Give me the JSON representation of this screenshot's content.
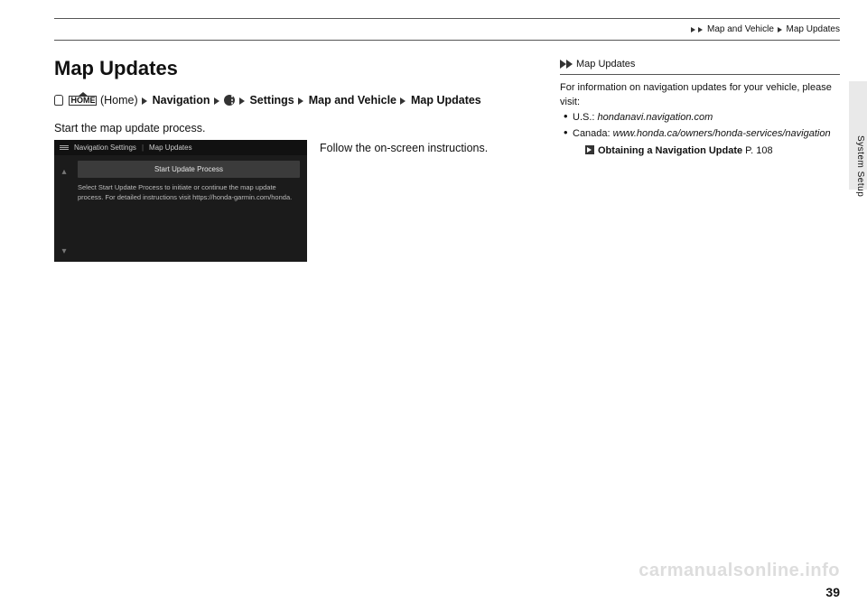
{
  "header": {
    "crumb1": "Map and Vehicle",
    "crumb2": "Map Updates"
  },
  "main": {
    "title": "Map Updates",
    "path": {
      "home_label": "(Home)",
      "nav": "Navigation",
      "settings": "Settings",
      "map_vehicle": "Map and Vehicle",
      "map_updates": "Map Updates"
    },
    "start_text": "Start the map update process.",
    "instruction": "Follow the on-screen instructions.",
    "screenshot": {
      "breadcrumb1": "Navigation Settings",
      "breadcrumb2": "Map Updates",
      "button": "Start Update Process",
      "body": "Select Start Update Process to initiate or continue the map update process. For detailed instructions visit https://honda-garmin.com/honda."
    }
  },
  "sidebar": {
    "tip_title": "Map Updates",
    "info_text": "For information on navigation updates for your vehicle, please visit:",
    "us_label": "U.S.: ",
    "us_url": "hondanavi.navigation.com",
    "ca_label": "Canada: ",
    "ca_url": "www.honda.ca/owners/honda-services/navigation",
    "xref_text": "Obtaining a Navigation Update",
    "xref_page": " P. 108"
  },
  "chrome": {
    "section_tab": "System Setup",
    "page_number": "39",
    "watermark": "carmanualsonline.info"
  }
}
